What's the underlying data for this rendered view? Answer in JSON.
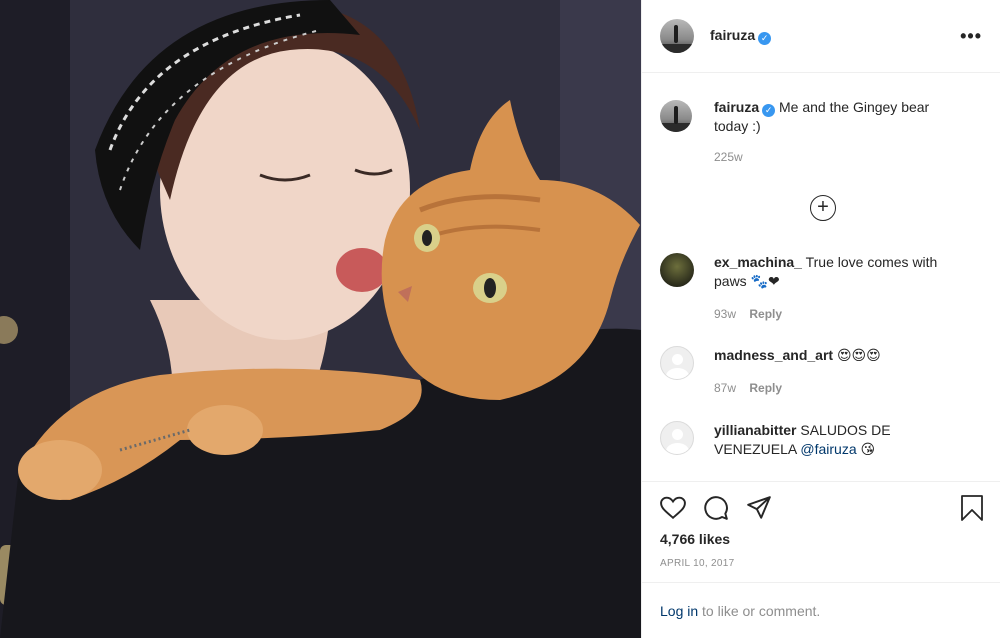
{
  "post": {
    "author": "fairuza",
    "more_label": "•••",
    "verified_glyph": "✓"
  },
  "caption": {
    "author": "fairuza",
    "text": "Me and the Gingey bear today :)",
    "age": "225w"
  },
  "load_more_glyph": "+",
  "comments": [
    {
      "user": "ex_machina_",
      "text": "True love comes with paws 🐾❤",
      "age": "93w",
      "reply": "Reply"
    },
    {
      "user": "madness_and_art",
      "text": "😍😍😍",
      "age": "87w",
      "reply": "Reply"
    },
    {
      "user": "yillianabitter",
      "text": "SALUDOS DE VENEZUELA",
      "mention": "@fairuza",
      "emoji": "😘"
    }
  ],
  "likes": "4,766 likes",
  "date": "APRIL 10, 2017",
  "login": {
    "link": "Log in",
    "rest": " to like or comment."
  },
  "icons": [
    "heart-icon",
    "comment-icon",
    "share-icon",
    "bookmark-icon",
    "verified-badge-icon",
    "more-options-icon",
    "add-comment-icon"
  ],
  "colors": {
    "verified": "#3897f0",
    "link": "#00376b",
    "muted": "#8e8e8e",
    "text": "#262626"
  }
}
